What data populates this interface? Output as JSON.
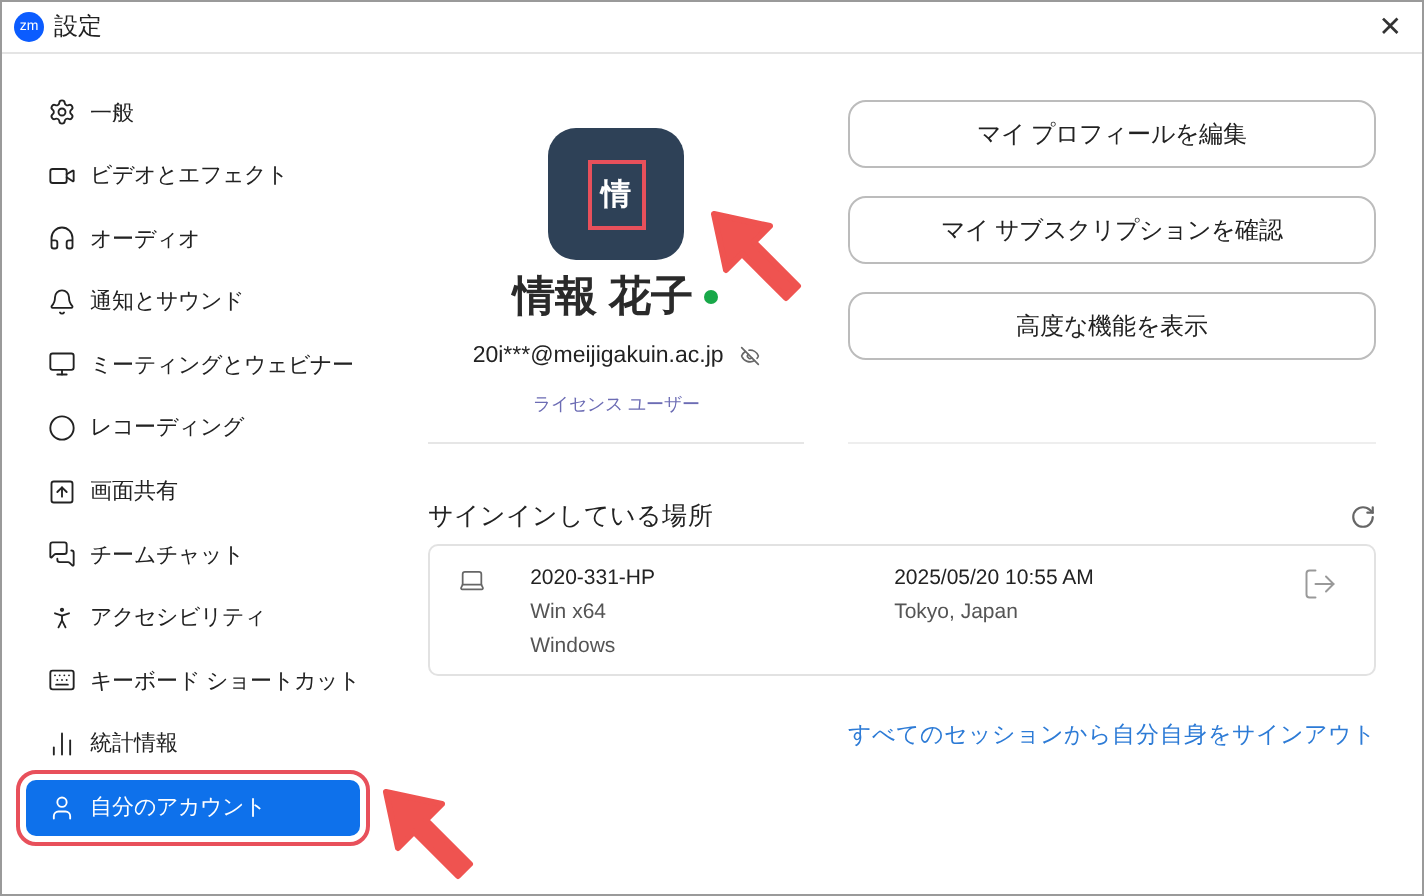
{
  "window": {
    "title": "設定",
    "logo": "zm",
    "close": "✕"
  },
  "sidebar": {
    "items": [
      {
        "label": "一般",
        "selected": false,
        "highlighted": false
      },
      {
        "label": "ビデオとエフェクト",
        "selected": false,
        "highlighted": false
      },
      {
        "label": "オーディオ",
        "selected": false,
        "highlighted": false
      },
      {
        "label": "通知とサウンド",
        "selected": false,
        "highlighted": false
      },
      {
        "label": "ミーティングとウェビナー",
        "selected": false,
        "highlighted": false
      },
      {
        "label": "レコーディング",
        "selected": false,
        "highlighted": false
      },
      {
        "label": "画面共有",
        "selected": false,
        "highlighted": false
      },
      {
        "label": "チームチャット",
        "selected": false,
        "highlighted": false
      },
      {
        "label": "アクセシビリティ",
        "selected": false,
        "highlighted": false
      },
      {
        "label": "キーボード ショートカット",
        "selected": false,
        "highlighted": false
      },
      {
        "label": "統計情報",
        "selected": false,
        "highlighted": false
      },
      {
        "label": "自分のアカウント",
        "selected": true,
        "highlighted": true
      }
    ]
  },
  "profile": {
    "avatar": {
      "initial": "情",
      "highlighted": true
    },
    "name": "情報 花子",
    "online": true,
    "email": "20i***@meijigakuin.ac.jp",
    "license": "ライセンス ユーザー"
  },
  "buttons": [
    "マイ プロフィールを編集",
    "マイ サブスクリプションを確認",
    "高度な機能を表示"
  ],
  "signin": {
    "heading": "サインインしている場所",
    "sessions": [
      {
        "device": "2020-331-HP",
        "arch": "Win x64",
        "os": "Windows",
        "time": "2025/05/20 10:55 AM",
        "location": "Tokyo, Japan"
      }
    ],
    "signout_all": "すべてのセッションから自分自身をサインアウト"
  }
}
